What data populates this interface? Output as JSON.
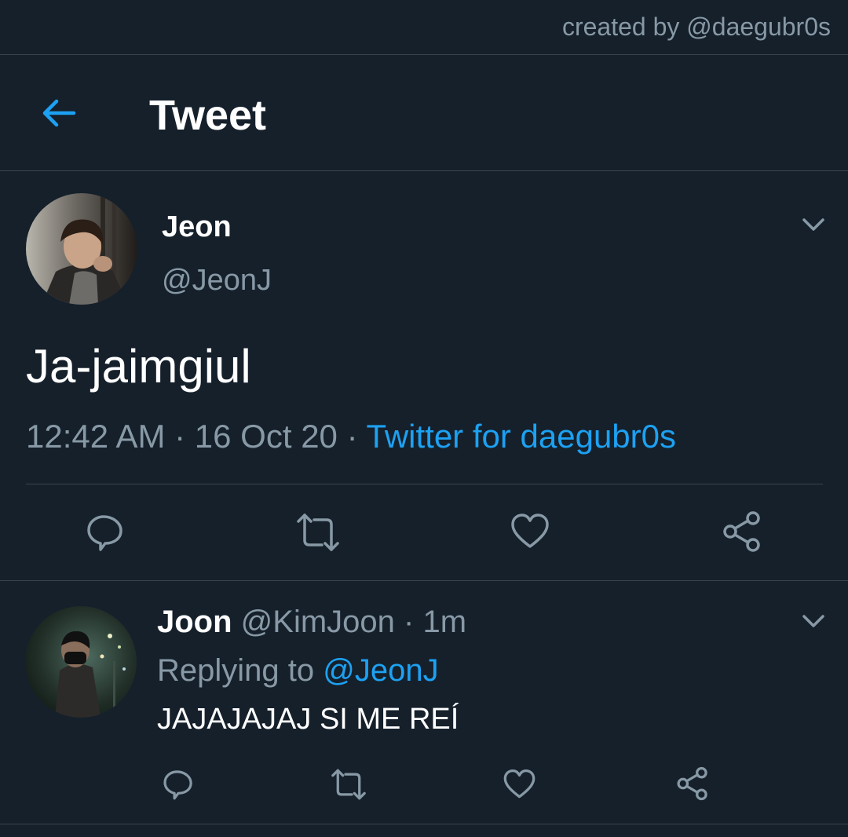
{
  "credit": "created by @daegubr0s",
  "header": {
    "title": "Tweet",
    "back_icon": "arrow-left-icon"
  },
  "tweet": {
    "name": "Jeon",
    "handle": "@JeonJ",
    "text": "Ja-jaimgiul",
    "time": "12:42 AM",
    "date": "16 Oct 20",
    "source": "Twitter for daegubr0s",
    "separator": " · "
  },
  "reply": {
    "name": "Joon",
    "handle": "@KimJoon",
    "age": "1m",
    "separator": " · ",
    "replying_label": "Replying to",
    "replying_to": "@JeonJ",
    "text": "JAJAJAJAJ SI ME REÍ"
  },
  "colors": {
    "background": "#15202b",
    "accent": "#1da1f2",
    "secondary_text": "#8899a6",
    "divider": "#38444d"
  }
}
